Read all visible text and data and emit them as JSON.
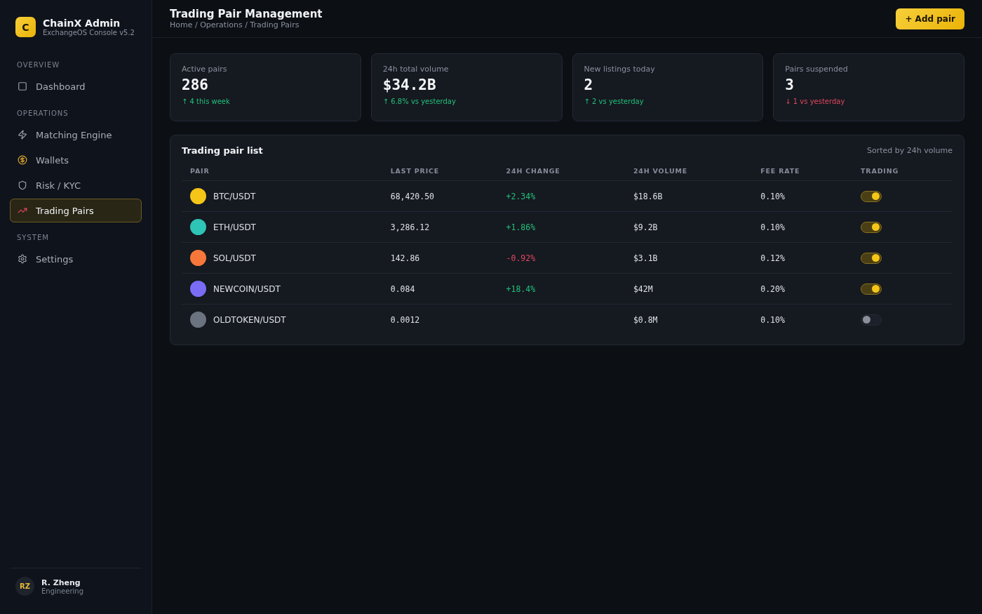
{
  "brand": {
    "logo": "C",
    "name": "ChainX Admin",
    "subtitle": "ExchangeOS Console v5.2"
  },
  "sidebar": {
    "sections": [
      {
        "title": "OVERVIEW",
        "items": [
          {
            "label": "Dashboard",
            "kind": "square",
            "selected": false
          }
        ]
      },
      {
        "title": "OPERATIONS",
        "items": [
          {
            "label": "Matching Engine",
            "kind": "bolt",
            "selected": false
          },
          {
            "label": "Wallets",
            "kind": "money",
            "selected": false
          },
          {
            "label": "Risk / KYC",
            "kind": "shield",
            "selected": false
          },
          {
            "label": "Trading Pairs",
            "kind": "chart",
            "selected": true
          }
        ]
      },
      {
        "title": "SYSTEM",
        "items": [
          {
            "label": "Settings",
            "kind": "gear",
            "selected": false
          }
        ]
      }
    ]
  },
  "user": {
    "initials": "RZ",
    "name": "R. Zheng",
    "role": "Engineering"
  },
  "header": {
    "title": "Trading Pair Management",
    "breadcrumb": "Home / Operations / Trading Pairs",
    "action": "+ Add pair"
  },
  "stats": [
    {
      "label": "Active pairs",
      "value": "286",
      "delta": "↑ 4 this week",
      "kind": "up"
    },
    {
      "label": "24h total volume",
      "value": "$34.2B",
      "delta": "↑ 6.8% vs yesterday",
      "kind": "up"
    },
    {
      "label": "New listings today",
      "value": "2",
      "delta": "↑ 2 vs yesterday",
      "kind": "up"
    },
    {
      "label": "Pairs suspended",
      "value": "3",
      "delta": "↓ 1 vs yesterday",
      "kind": "down"
    }
  ],
  "table": {
    "title": "Trading pair list",
    "note": "Sorted by 24h volume",
    "columns": [
      "PAIR",
      "LAST PRICE",
      "24H CHANGE",
      "24H VOLUME",
      "FEE RATE",
      "TRADING"
    ],
    "rows": [
      {
        "pair": "BTC/USDT",
        "color": "#f5c518",
        "price": "68,420.50",
        "change": "+2.34%",
        "kind": "up",
        "volume": "$18.6B",
        "fee": "0.10%",
        "on": true
      },
      {
        "pair": "ETH/USDT",
        "color": "#2ec4b6",
        "price": "3,286.12",
        "change": "+1.86%",
        "kind": "up",
        "volume": "$9.2B",
        "fee": "0.10%",
        "on": true
      },
      {
        "pair": "SOL/USDT",
        "color": "#f7773a",
        "price": "142.86",
        "change": "-0.92%",
        "kind": "down",
        "volume": "$3.1B",
        "fee": "0.12%",
        "on": true
      },
      {
        "pair": "NEWCOIN/USDT",
        "color": "#7b6cf6",
        "price": "0.084",
        "change": "+18.4%",
        "kind": "up",
        "volume": "$42M",
        "fee": "0.20%",
        "on": true
      },
      {
        "pair": "OLDTOKEN/USDT",
        "color": "#6b7280",
        "price": "0.0012",
        "volume": "$0.8M",
        "fee": "0.10%",
        "on": false
      }
    ]
  }
}
